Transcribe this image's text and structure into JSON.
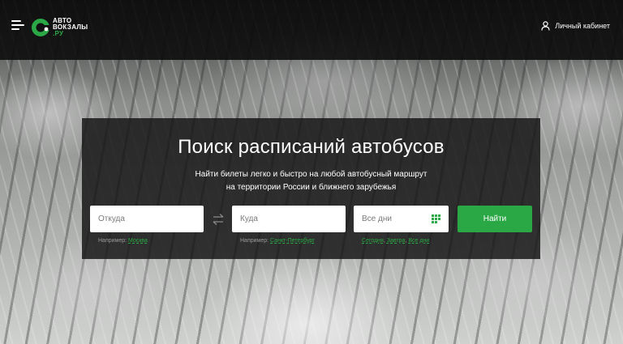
{
  "header": {
    "logo_line1": "АВТО",
    "logo_line2": "ВОКЗАЛЫ",
    "logo_line3": ".РУ",
    "account_label": "Личный кабинет"
  },
  "hero": {
    "title": "Поиск расписаний автобусов",
    "subtitle_line1": "Найти билеты легко и быстро на любой автобусный маршрут",
    "subtitle_line2": "на территории России и ближнего зарубежья"
  },
  "search": {
    "from_placeholder": "Откуда",
    "to_placeholder": "Куда",
    "date_value": "Все дни",
    "submit_label": "Найти",
    "from_hint_prefix": "Например:",
    "from_hint_link": "Москва",
    "to_hint_prefix": "Например:",
    "to_hint_link": "Санкт-Петербург",
    "date_hint_today": "Сегодня",
    "date_hint_tomorrow": "Завтра",
    "date_hint_all": "Все дни"
  },
  "colors": {
    "accent": "#2aa845",
    "panel": "#161616",
    "header": "#0a0a0a"
  },
  "icons": {
    "menu": "hamburger-icon",
    "account": "user-icon",
    "swap": "swap-arrows-icon",
    "calendar": "calendar-icon"
  }
}
